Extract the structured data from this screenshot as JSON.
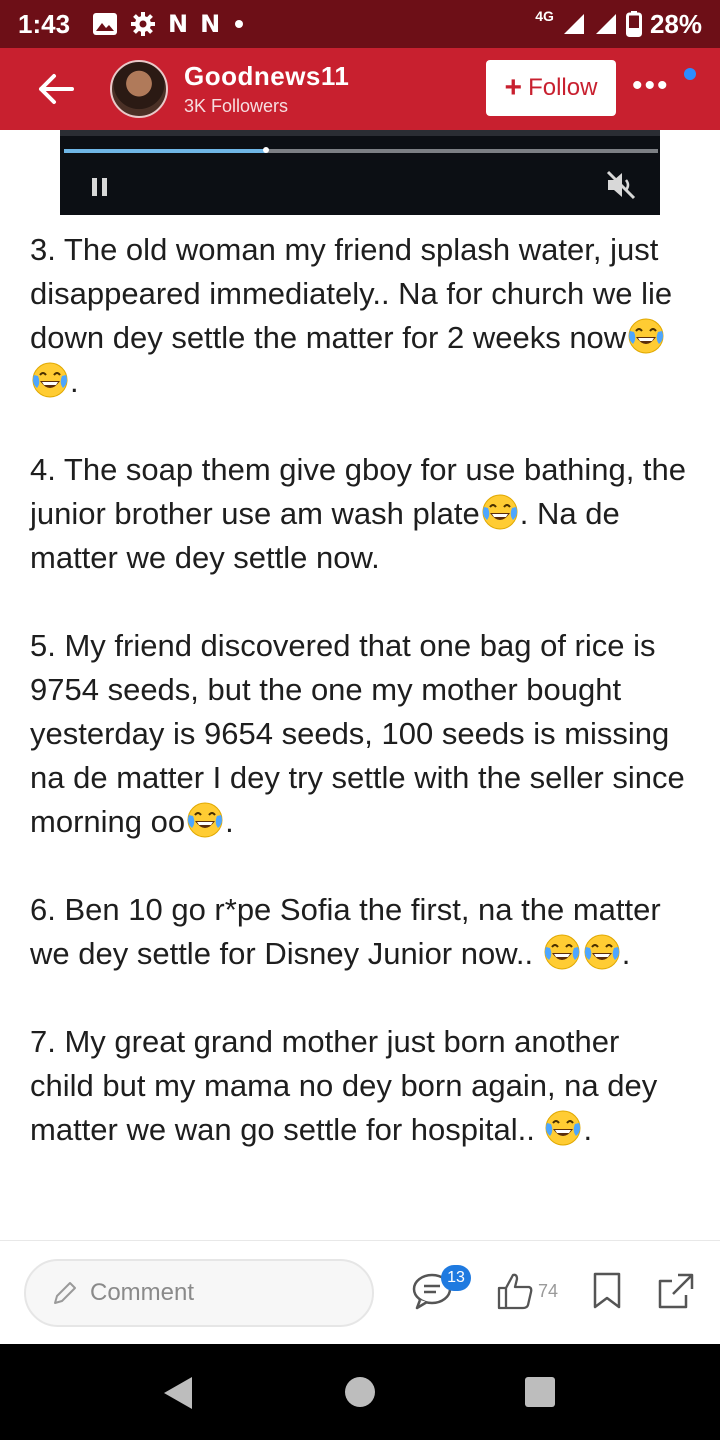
{
  "status_bar": {
    "time": "1:43",
    "icons": [
      "image-icon",
      "gear-icon",
      "n-icon",
      "n-icon",
      "dot-icon"
    ],
    "network": "4G",
    "battery": "28%"
  },
  "header": {
    "username": "Goodnews11",
    "followers": "3K Followers",
    "follow_label": "Follow",
    "follow_icon": "+",
    "more_label": "•••",
    "accent_color": "#c8202f"
  },
  "video": {
    "progress": 0.34
  },
  "article": {
    "paragraphs": [
      {
        "parts": [
          "3. The old woman my friend splash water, just disappeared immediately.. Na for church we lie down dey settle the matter for 2 weeks now",
          "."
        ],
        "emojis_after_part0": 2
      },
      {
        "parts": [
          "4. The soap them give gboy for use bathing, the junior brother use am wash plate",
          ". Na de matter we dey settle now."
        ],
        "emojis_after_part0": 1
      },
      {
        "parts": [
          "5. My friend discovered that one bag of rice is 9754 seeds, but the one my mother bought yesterday is 9654 seeds, 100 seeds is missing na de matter I dey try settle with the seller since morning oo",
          "."
        ],
        "emojis_after_part0": 1
      },
      {
        "parts": [
          "6. Ben 10 go r*pe Sofia the first, na the matter we dey settle for Disney Junior now.. ",
          "."
        ],
        "emojis_after_part0": 2
      },
      {
        "parts": [
          "7. My great grand mother just born another child but my mama no dey born again, na dey matter we wan go settle for hospital.. ",
          "."
        ],
        "emojis_after_part0": 1
      }
    ]
  },
  "actions": {
    "comment_placeholder": "Comment",
    "comment_count": "13",
    "like_count": "74"
  }
}
